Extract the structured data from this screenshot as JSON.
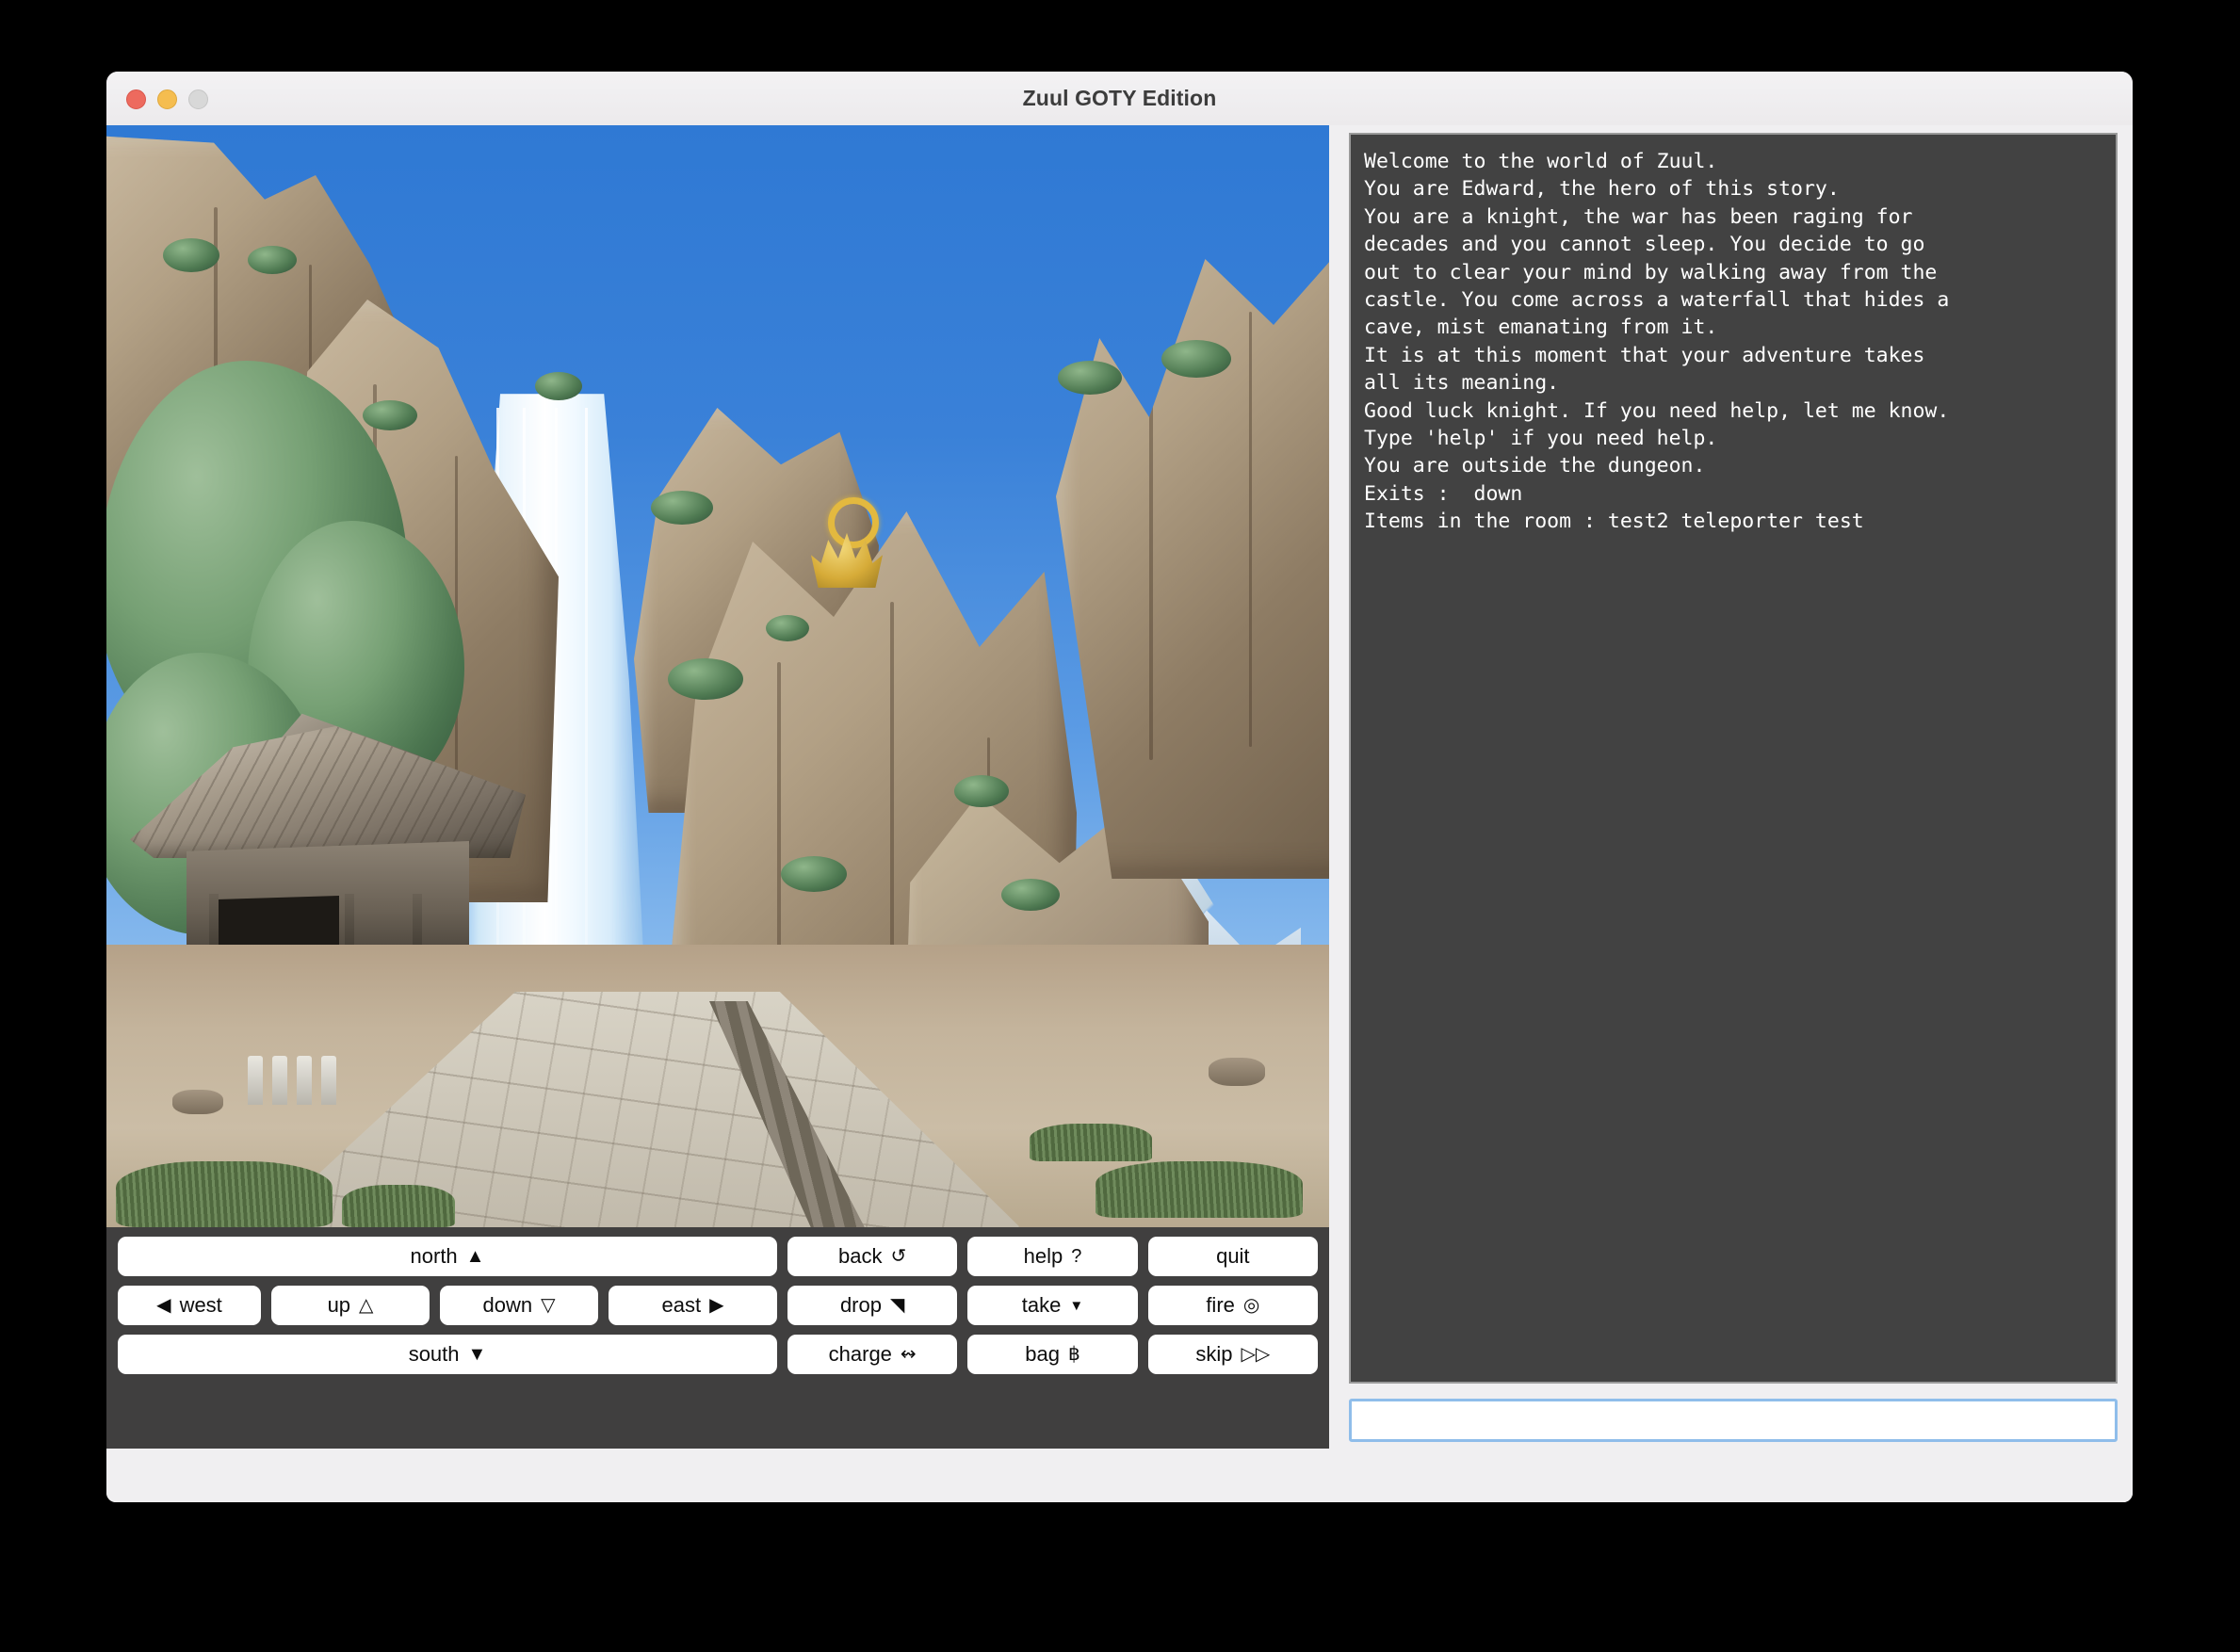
{
  "window": {
    "title": "Zuul GOTY Edition",
    "traffic_lights": [
      "close-red",
      "minimize-yellow",
      "zoom-gray"
    ]
  },
  "scene": {
    "name": "waterfall-dungeon-entrance",
    "description": "Pixel-art waterfall scene with cliffs, a wooden temple, stone path and a golden shrine ornament"
  },
  "console": {
    "lines": [
      "Welcome to the world of Zuul.",
      "You are Edward, the hero of this story.",
      "You are a knight, the war has been raging for",
      "decades and you cannot sleep. You decide to go",
      "out to clear your mind by walking away from the",
      "castle. You come across a waterfall that hides a",
      "cave, mist emanating from it.",
      "It is at this moment that your adventure takes",
      "all its meaning.",
      "Good luck knight. If you need help, let me know.",
      "Type 'help' if you need help.",
      "You are outside the dungeon.",
      "Exits :  down",
      "Items in the room : test2 teleporter test"
    ],
    "text": "Welcome to the world of Zuul.\nYou are Edward, the hero of this story.\nYou are a knight, the war has been raging for\ndecades and you cannot sleep. You decide to go\nout to clear your mind by walking away from the\ncastle. You come across a waterfall that hides a\ncave, mist emanating from it.\nIt is at this moment that your adventure takes\nall its meaning.\nGood luck knight. If you need help, let me know.\nType 'help' if you need help.\nYou are outside the dungeon.\nExits :  down\nItems in the room : test2 teleporter test",
    "background_color": "#424242",
    "text_color": "#ffffff"
  },
  "command_input": {
    "value": "",
    "placeholder": "",
    "focused": true,
    "focus_ring_color": "#8fbdea"
  },
  "buttons": {
    "north": {
      "label": "north",
      "glyph": "▲",
      "glyph_name": "triangle-up-filled-icon"
    },
    "west": {
      "label": "west",
      "glyph": "◀",
      "glyph_name": "triangle-left-filled-icon"
    },
    "up": {
      "label": "up",
      "glyph": "△",
      "glyph_name": "triangle-up-outline-icon"
    },
    "down": {
      "label": "down",
      "glyph": "▽",
      "glyph_name": "triangle-down-outline-icon"
    },
    "east": {
      "label": "east",
      "glyph": "▶",
      "glyph_name": "triangle-right-filled-icon"
    },
    "south": {
      "label": "south",
      "glyph": "▼",
      "glyph_name": "triangle-down-filled-icon"
    },
    "back": {
      "label": "back",
      "glyph": "↺",
      "glyph_name": "undo-arrow-icon"
    },
    "help": {
      "label": "help",
      "glyph": "?",
      "glyph_name": "question-mark-icon"
    },
    "quit": {
      "label": "quit",
      "glyph": "",
      "glyph_name": "none"
    },
    "drop": {
      "label": "drop",
      "glyph": "◥",
      "glyph_name": "drop-marker-icon"
    },
    "take": {
      "label": "take",
      "glyph": "▼",
      "glyph_name": "take-marker-icon"
    },
    "fire": {
      "label": "fire",
      "glyph": "◎",
      "glyph_name": "target-bullseye-icon"
    },
    "charge": {
      "label": "charge",
      "glyph": "↭",
      "glyph_name": "lightning-squiggle-icon"
    },
    "bag": {
      "label": "bag",
      "glyph": "฿",
      "glyph_name": "baht-bag-icon"
    },
    "skip": {
      "label": "skip",
      "glyph": "▷▷",
      "glyph_name": "double-triangle-right-icon"
    }
  },
  "colors": {
    "panel_background": "#403f3f",
    "console_background": "#424242",
    "titlebar_background": "#f0eff1",
    "button_background": "#ffffff",
    "accent_focus": "#8fbdea",
    "sky_blue": "#2f79d4"
  }
}
